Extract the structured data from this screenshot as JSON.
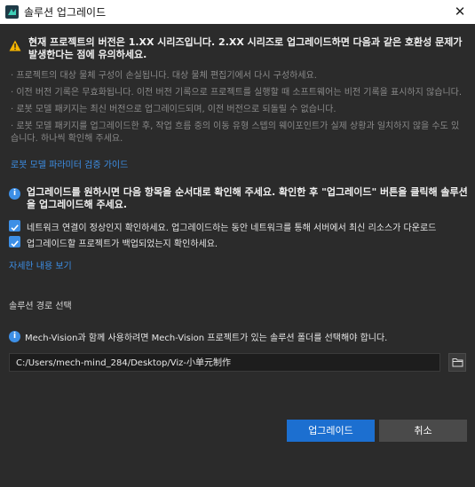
{
  "window": {
    "title": "솔루션 업그레이드",
    "close_glyph": "✕"
  },
  "warning": {
    "icon": "warning-triangle-icon",
    "text": "현재 프로젝트의 버전은 1.XX 시리즈입니다. 2.XX 시리즈로 업그레이드하면 다음과 같은 호환성 문제가 발생한다는 점에 유의하세요.",
    "bullets": [
      "· 프로젝트의 대상 물체 구성이 손실됩니다. 대상 물체 편집기에서 다시 구성하세요.",
      "· 이전 버전 기록은 무효화됩니다. 이전 버전 기록으로 프로젝트를 실행할 때 소프트웨어는 비전 기록을 표시하지 않습니다.",
      "· 로봇 모델 패키지는 최신 버전으로 업그레이드되며, 이전 버전으로 되돌릴 수 없습니다.",
      "· 로봇 모델 패키지를 업그레이드한 후, 작업 흐름 중의 이동 유형 스텝의 웨이포인트가 실제 상황과 일치하지 않을 수도 있습니다. 하나씩 확인해 주세요."
    ],
    "guide_link": "로봇 모델 파라미터 검증 가이드"
  },
  "confirm": {
    "icon": "info-icon",
    "text": "업그레이드를 원하시면 다음 항목을 순서대로 확인해 주세요. 확인한 후 \"업그레이드\" 버튼을 클릭해 솔루션을 업그레이드해 주세요.",
    "checks": [
      {
        "label": "네트워크 연결이 정상인지 확인하세요. 업그레이드하는 동안 네트워크를 통해 서버에서 최신 리소스가 다운로드",
        "checked": true
      },
      {
        "label": "업그레이드할 프로젝트가 백업되었는지 확인하세요.",
        "checked": true
      }
    ],
    "details_link": "자세한 내용 보기"
  },
  "path_section": {
    "label": "솔루션 경로 선택",
    "info": "Mech-Vision과 함께 사용하려면 Mech-Vision 프로젝트가 있는 솔루션 폴더를 선택해야 합니다.",
    "path_value": "C:/Users/mech-mind_284/Desktop/Viz-小单元制作"
  },
  "buttons": {
    "upgrade": "업그레이드",
    "cancel": "취소"
  },
  "colors": {
    "accent": "#3d8fe6",
    "primary_button": "#1c6fd0",
    "warning": "#f5b400",
    "background": "#2b2b2b"
  }
}
